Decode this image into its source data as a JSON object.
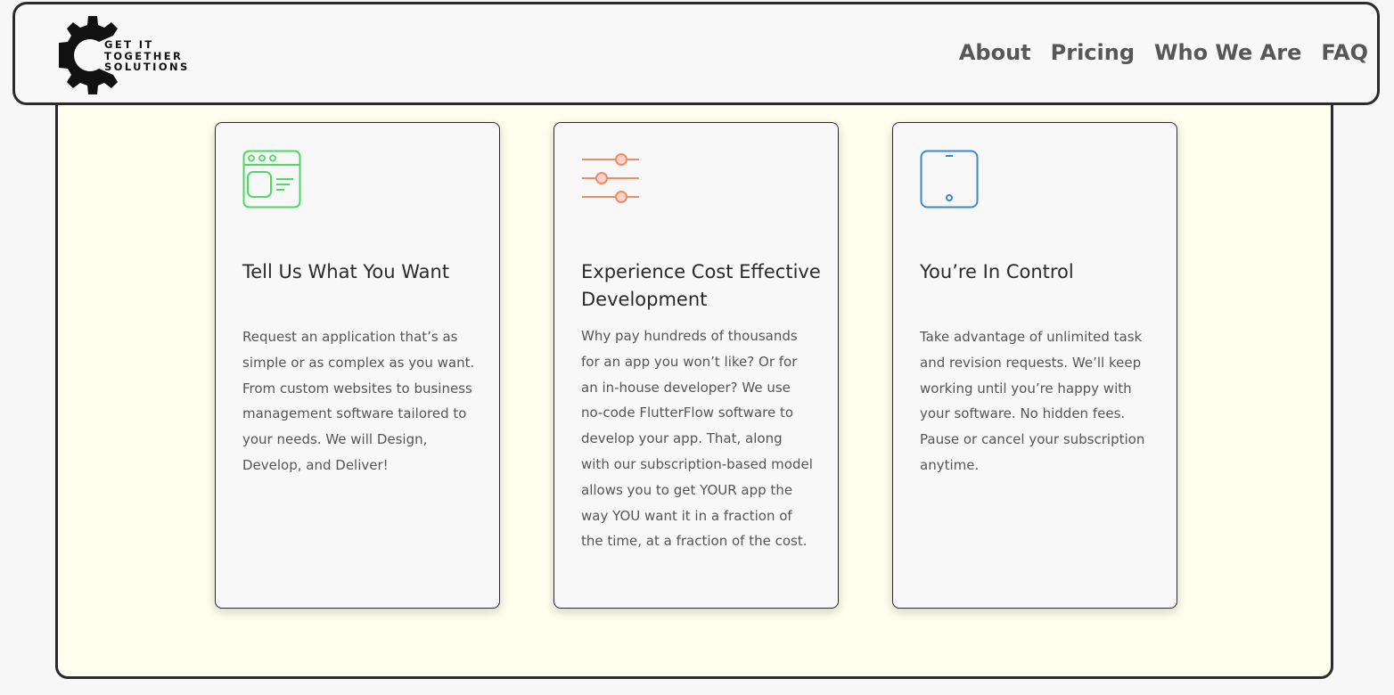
{
  "brand": {
    "logo_lines": [
      "GET IT",
      "TOGETHER",
      "SOLUTIONS"
    ],
    "logo_icon": "gear-icon"
  },
  "nav": {
    "items": [
      {
        "label": "About"
      },
      {
        "label": "Pricing"
      },
      {
        "label": "Who We Are"
      },
      {
        "label": "FAQ"
      }
    ]
  },
  "colors": {
    "green_icon": "#4cd964",
    "orange_icon": "#f08a6a",
    "blue_icon": "#3a86d6",
    "panel_bg": "#fffff0"
  },
  "cards": [
    {
      "icon": "browser-window-icon",
      "title": "Tell Us What You Want",
      "body": "Request an application that’s as simple or as complex as you want. From custom websites to business management software tailored to your needs. We will Design, Develop, and Deliver!"
    },
    {
      "icon": "sliders-icon",
      "title": "Experience Cost Effective Development",
      "body": "Why pay hundreds of thousands for an app you won’t like? Or for an in-house developer? We use no-code FlutterFlow software to develop your app. That, along with our subscription-based model allows you to get YOUR app the way YOU want it in a fraction of the time, at a fraction of the cost."
    },
    {
      "icon": "tablet-icon",
      "title": "You’re In Control",
      "body": "Take advantage of unlimited task and revision requests. We’ll keep working until you’re happy with your software. No hidden fees. Pause or cancel your subscription anytime."
    }
  ]
}
